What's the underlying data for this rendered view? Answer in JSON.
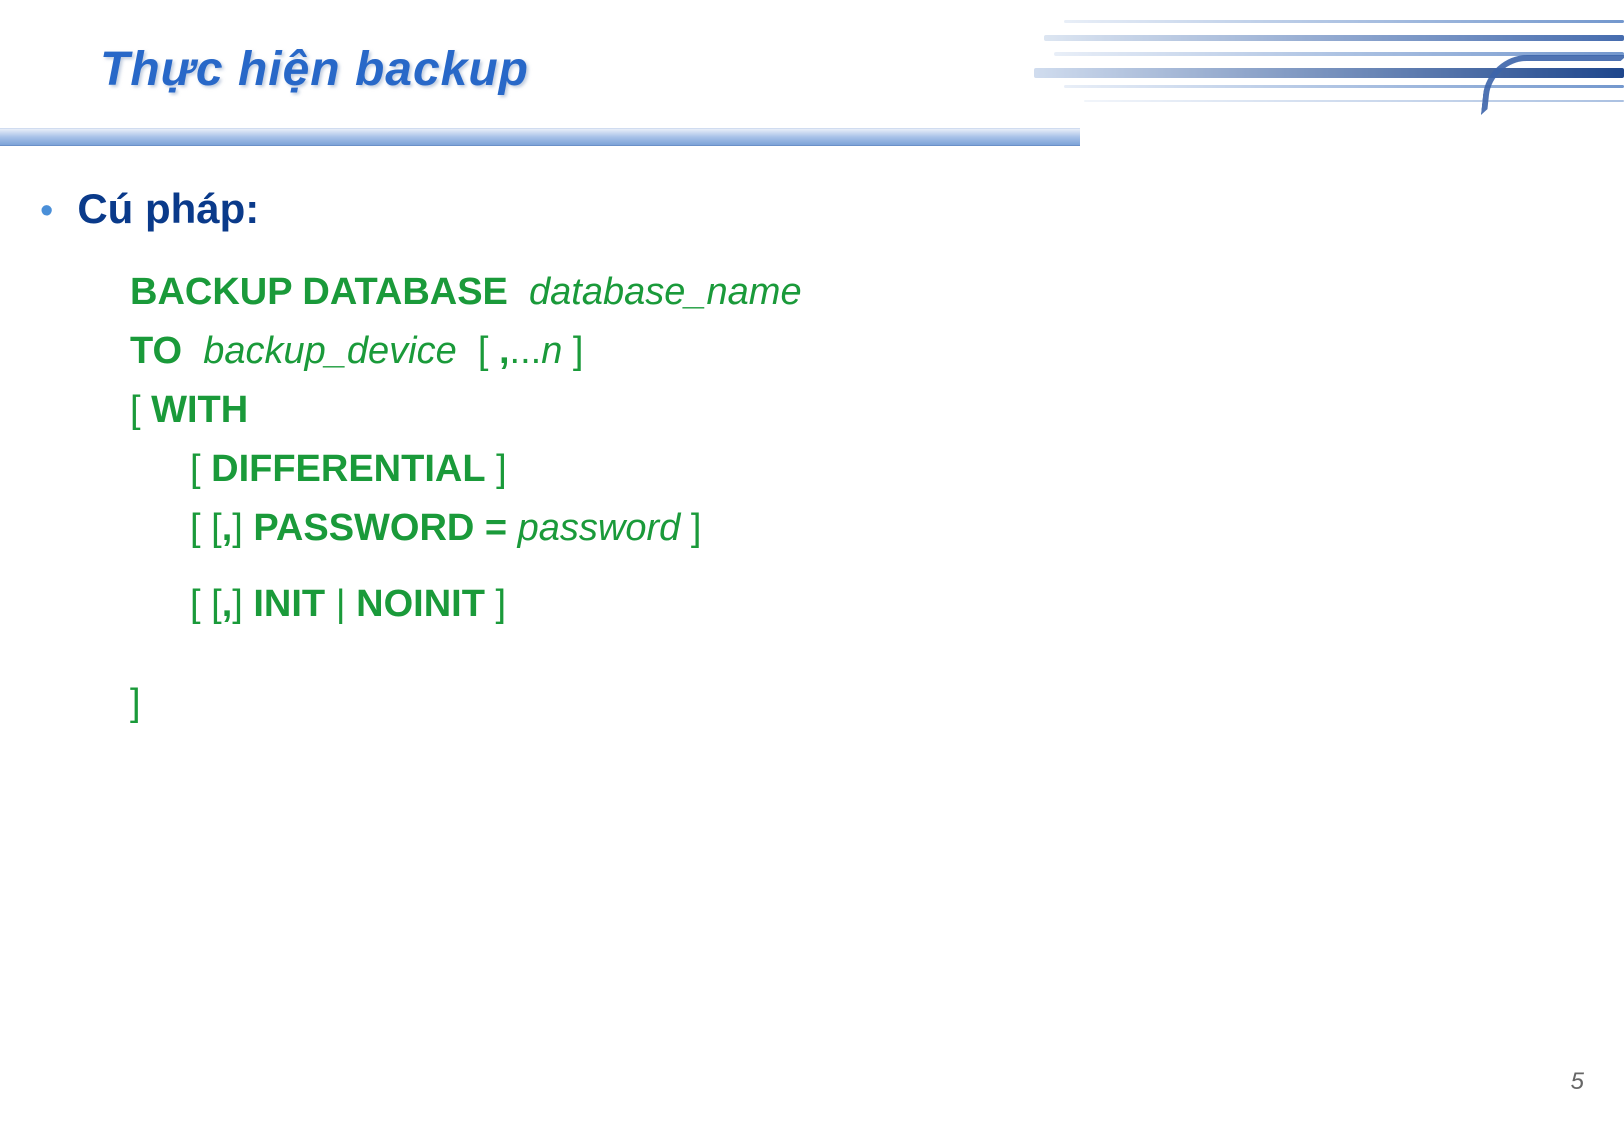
{
  "slide": {
    "title": "Thực hiện backup",
    "bullet_label": "Cú pháp:",
    "page_number": "5"
  },
  "code": {
    "line1": {
      "kw1": "BACKUP DATABASE",
      "arg1": "database_name"
    },
    "line2": {
      "kw1": "TO",
      "arg1": "backup_device",
      "rest_a": "  [ ",
      "rest_b": ",",
      "rest_c": "...",
      "rest_d": "n",
      "rest_e": " ]"
    },
    "line3": {
      "a": "[ ",
      "kw1": "WITH"
    },
    "line4": {
      "a": "[ ",
      "kw1": "DIFFERENTIAL",
      "b": " ]"
    },
    "line5": {
      "a": "[ [",
      "b": ",",
      "c": "] ",
      "kw1": "PASSWORD =",
      "d": " ",
      "arg1": "password",
      "e": " ]"
    },
    "line6": {
      "a": "[ [",
      "b": ",",
      "c": "] ",
      "kw1": "INIT",
      "d": " | ",
      "kw2": "NOINIT",
      "e": " ]"
    },
    "line7": {
      "a": "]"
    }
  }
}
